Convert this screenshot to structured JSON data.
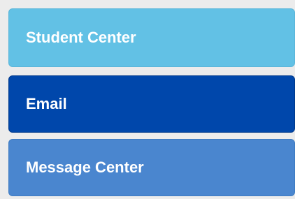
{
  "nav": {
    "items": [
      {
        "label": "Student Center",
        "color": "#62C1E5"
      },
      {
        "label": "Email",
        "color": "#0047AB"
      },
      {
        "label": "Message Center",
        "color": "#4A86CF"
      }
    ]
  }
}
